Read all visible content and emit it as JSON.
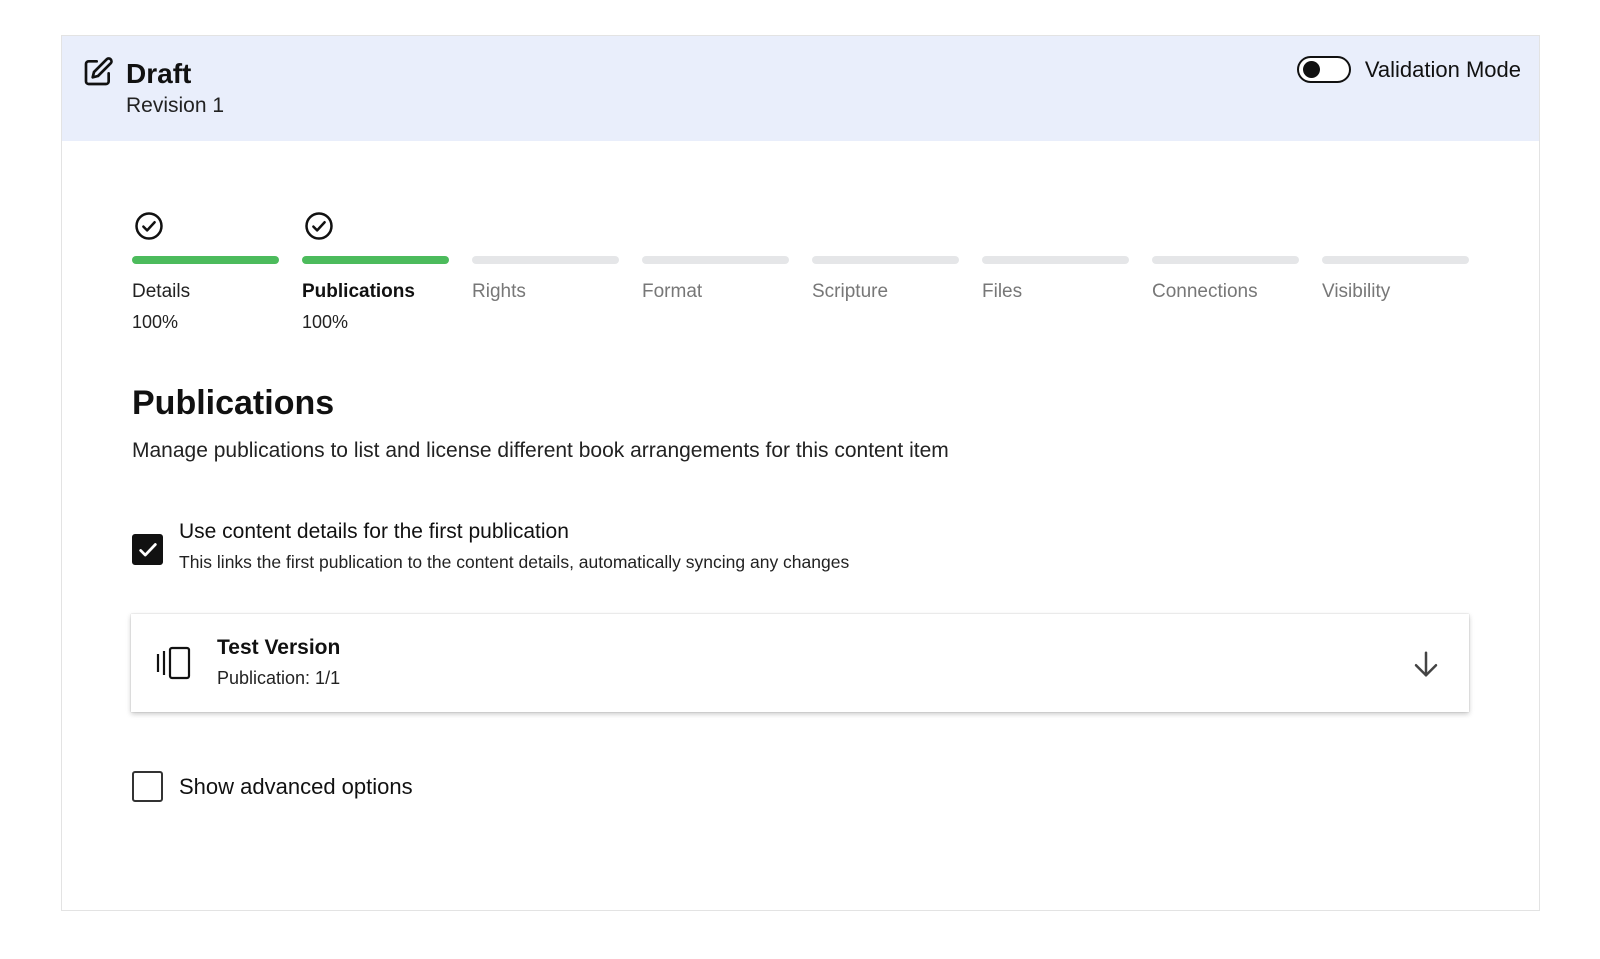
{
  "header": {
    "title": "Draft",
    "revision": "Revision 1",
    "validation_toggle": {
      "label": "Validation Mode",
      "on": false
    }
  },
  "steps": [
    {
      "label": "Details",
      "percent": "100%",
      "complete": true,
      "active": false
    },
    {
      "label": "Publications",
      "percent": "100%",
      "complete": true,
      "active": true
    },
    {
      "label": "Rights",
      "percent": "",
      "complete": false,
      "active": false
    },
    {
      "label": "Format",
      "percent": "",
      "complete": false,
      "active": false
    },
    {
      "label": "Scripture",
      "percent": "",
      "complete": false,
      "active": false
    },
    {
      "label": "Files",
      "percent": "",
      "complete": false,
      "active": false
    },
    {
      "label": "Connections",
      "percent": "",
      "complete": false,
      "active": false
    },
    {
      "label": "Visibility",
      "percent": "",
      "complete": false,
      "active": false
    }
  ],
  "section": {
    "title": "Publications",
    "description": "Manage publications to list and license different book arrangements for this content item"
  },
  "use_content_details": {
    "label": "Use content details for the first publication",
    "sublabel": "This links the first publication to the content details, automatically syncing any changes",
    "checked": true
  },
  "publication": {
    "title": "Test Version",
    "subtitle": "Publication: 1/1",
    "icon": "carousel-icon",
    "expand_icon": "arrow-down-icon"
  },
  "advanced": {
    "label": "Show advanced options",
    "checked": false
  },
  "colors": {
    "header_bg": "#e9eefb",
    "progress_complete": "#4cbb5c",
    "progress_incomplete": "#e5e6e8"
  }
}
